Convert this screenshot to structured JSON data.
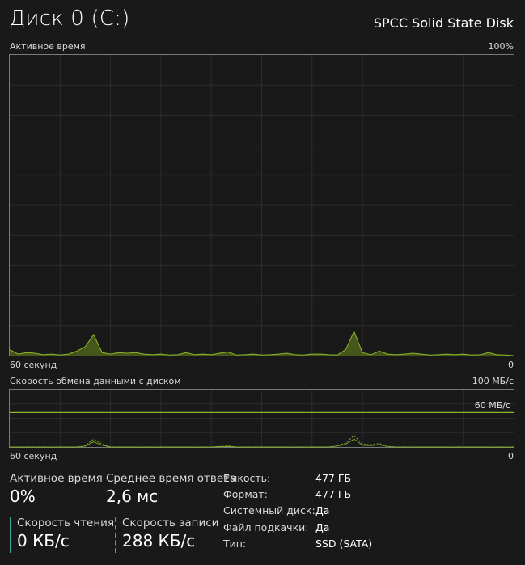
{
  "header": {
    "title": "Диск 0 (C:)",
    "model": "SPCC Solid State Disk"
  },
  "chart1": {
    "label": "Активное время",
    "max_label": "100%",
    "time_left": "60 секунд",
    "time_right": "0",
    "color_fill": "#4a5e1c",
    "color_line": "#8ab827"
  },
  "chart2": {
    "label": "Скорость обмена данными с диском",
    "max_label": "100 МБ/с",
    "ref_label": "60 МБ/с",
    "time_left": "60 секунд",
    "time_right": "0",
    "color_line": "#8ab827"
  },
  "stats": {
    "active_time_label": "Активное время",
    "active_time_value": "0%",
    "response_label": "Среднее время ответа",
    "response_value": "2,6 мс",
    "read_label": "Скорость чтения",
    "read_value": "0 КБ/с",
    "write_label": "Скорость записи",
    "write_value": "288 КБ/с"
  },
  "properties": [
    {
      "label": "Емкость:",
      "value": "477 ГБ"
    },
    {
      "label": "Формат:",
      "value": "477 ГБ"
    },
    {
      "label": "Системный диск:",
      "value": "Да"
    },
    {
      "label": "Файл подкачки:",
      "value": "Да"
    },
    {
      "label": "Тип:",
      "value": "SSD (SATA)"
    }
  ],
  "chart_data": [
    {
      "type": "area",
      "title": "Активное время",
      "ylim": [
        0,
        100
      ],
      "x": [
        60,
        59,
        58,
        57,
        56,
        55,
        54,
        53,
        52,
        51,
        50,
        49,
        48,
        47,
        46,
        45,
        44,
        43,
        42,
        41,
        40,
        39,
        38,
        37,
        36,
        35,
        34,
        33,
        32,
        31,
        30,
        29,
        28,
        27,
        26,
        25,
        24,
        23,
        22,
        21,
        20,
        19,
        18,
        17,
        16,
        15,
        14,
        13,
        12,
        11,
        10,
        9,
        8,
        7,
        6,
        5,
        4,
        3,
        2,
        1,
        0
      ],
      "series": [
        {
          "values": [
            2,
            0.5,
            1,
            0.8,
            0.3,
            0.5,
            0.2,
            0.5,
            1.5,
            3,
            7,
            1,
            0.5,
            1,
            0.8,
            1,
            0.5,
            0.3,
            0.5,
            0.2,
            0.3,
            1,
            0.3,
            0.5,
            0.3,
            0.8,
            1.2,
            0.2,
            0.3,
            0.5,
            0.2,
            0.3,
            0.5,
            0.8,
            0.3,
            0.2,
            0.5,
            0.5,
            0.3,
            0.2,
            2,
            8,
            1,
            0.3,
            1.5,
            0.5,
            0.3,
            0.5,
            0.8,
            0.5,
            0.2,
            0.3,
            0.5,
            0.3,
            0.5,
            0.2,
            0.3,
            1,
            0.3,
            0.2,
            0
          ]
        }
      ]
    },
    {
      "type": "line",
      "title": "Скорость обмена данными с диском",
      "ylim": [
        0,
        100
      ],
      "x": [
        60,
        59,
        58,
        57,
        56,
        55,
        54,
        53,
        52,
        51,
        50,
        49,
        48,
        47,
        46,
        45,
        44,
        43,
        42,
        41,
        40,
        39,
        38,
        37,
        36,
        35,
        34,
        33,
        32,
        31,
        30,
        29,
        28,
        27,
        26,
        25,
        24,
        23,
        22,
        21,
        20,
        19,
        18,
        17,
        16,
        15,
        14,
        13,
        12,
        11,
        10,
        9,
        8,
        7,
        6,
        5,
        4,
        3,
        2,
        1,
        0
      ],
      "series": [
        {
          "values": [
            0,
            0,
            0,
            0,
            0,
            0,
            0,
            0,
            0,
            2,
            14,
            5,
            0,
            0,
            0,
            0,
            0,
            0,
            0,
            0,
            0,
            0,
            0,
            0,
            0,
            1,
            2,
            0,
            0,
            0,
            0,
            0,
            0,
            0,
            0,
            0,
            0,
            0,
            0,
            2,
            7,
            20,
            5,
            4,
            6,
            1,
            0,
            0,
            0,
            0,
            0,
            0,
            0,
            0,
            0,
            0,
            0,
            0,
            0,
            0,
            0
          ]
        },
        {
          "values": [
            0,
            0,
            0,
            0,
            0,
            0,
            0,
            0,
            0,
            1.5,
            9,
            3,
            0,
            0,
            0,
            0,
            0,
            0,
            0,
            0,
            0,
            0,
            0,
            0,
            0,
            0.5,
            1,
            0,
            0,
            0,
            0,
            0,
            0,
            0,
            0,
            0,
            0,
            0,
            0,
            1.5,
            5,
            14,
            3,
            2.5,
            4,
            0.5,
            0,
            0,
            0,
            0,
            0,
            0,
            0,
            0,
            0,
            0,
            0,
            0,
            0,
            0,
            0
          ]
        }
      ],
      "reference_line": 60
    }
  ]
}
